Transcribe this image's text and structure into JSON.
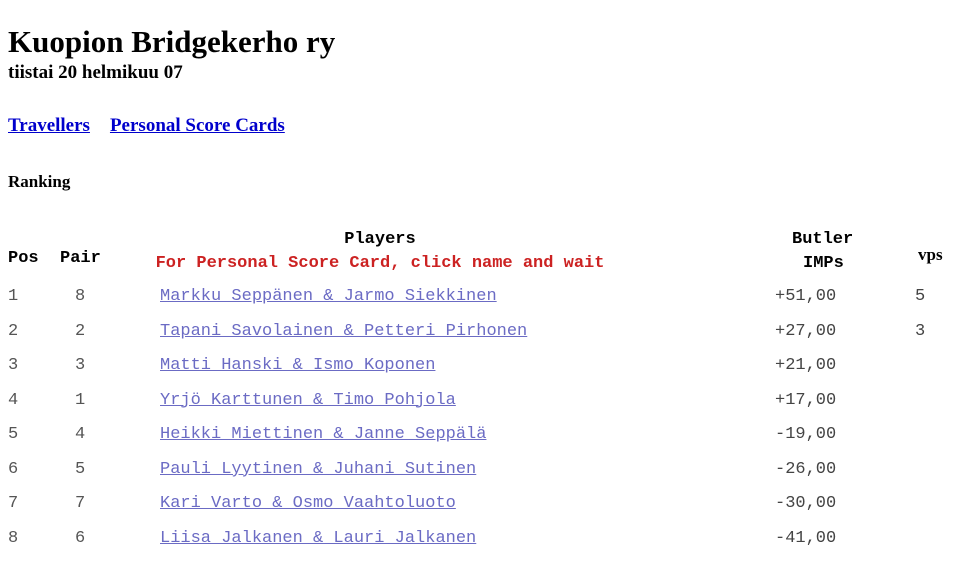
{
  "header": {
    "club_title": "Kuopion Bridgekerho ry",
    "date": "tiistai 20 helmikuu 07",
    "links": [
      {
        "label": "Travellers"
      },
      {
        "label": "Personal Score Cards"
      }
    ]
  },
  "section": {
    "title": "Ranking"
  },
  "table": {
    "columns": {
      "pos": "Pos",
      "pair": "Pair",
      "players": "Players",
      "players_note": "For Personal Score Card, click name and wait",
      "butler": "Butler",
      "imps": "IMPs",
      "vps": "vps"
    },
    "rows": [
      {
        "pos": "1",
        "pair": "8",
        "players": "Markku Seppänen & Jarmo Siekkinen",
        "imps": "+51,00",
        "vps": "5"
      },
      {
        "pos": "2",
        "pair": "2",
        "players": "Tapani Savolainen & Petteri Pirhonen",
        "imps": "+27,00",
        "vps": "3"
      },
      {
        "pos": "3",
        "pair": "3",
        "players": "Matti Hanski & Ismo Koponen",
        "imps": "+21,00",
        "vps": ""
      },
      {
        "pos": "4",
        "pair": "1",
        "players": "Yrjö Karttunen & Timo Pohjola",
        "imps": "+17,00",
        "vps": ""
      },
      {
        "pos": "5",
        "pair": "4",
        "players": "Heikki Miettinen & Janne Seppälä",
        "imps": "-19,00",
        "vps": ""
      },
      {
        "pos": "6",
        "pair": "5",
        "players": "Pauli Lyytinen & Juhani Sutinen",
        "imps": "-26,00",
        "vps": ""
      },
      {
        "pos": "7",
        "pair": "7",
        "players": "Kari Varto & Osmo Vaahtoluoto",
        "imps": "-30,00",
        "vps": ""
      },
      {
        "pos": "8",
        "pair": "6",
        "players": "Liisa Jalkanen & Lauri Jalkanen",
        "imps": "-41,00",
        "vps": ""
      }
    ]
  },
  "colors": {
    "nav_link": "#0000cc",
    "player_link": "#6b6bc4",
    "note_red": "#cc2222",
    "text": "#000000",
    "background": "#ffffff"
  }
}
